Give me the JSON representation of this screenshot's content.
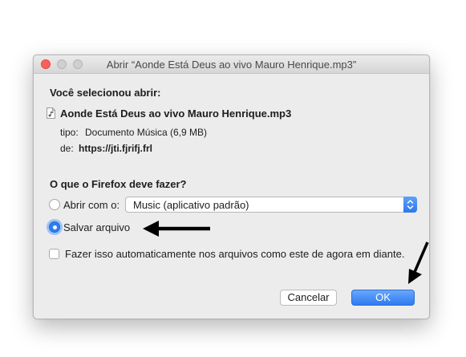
{
  "dialog": {
    "window_title": "Abrir “Aonde Está Deus ao vivo Mauro Henrique.mp3”",
    "heading": "Você selecionou abrir:",
    "file_name": "Aonde Está Deus ao vivo Mauro Henrique.mp3",
    "file_icon": "audio-file-icon",
    "type_label": "tipo:",
    "type_value": "Documento Música (6,9 MB)",
    "from_label": "de:",
    "from_value": "https://jti.fjrifj.frl",
    "question": "O que o Firefox deve fazer?",
    "open_with_label": "Abrir com o:",
    "open_with_selected": "Music (aplicativo padrão)",
    "save_label": "Salvar arquivo",
    "selected_option": "save",
    "auto_checkbox_label": "Fazer isso automaticamente nos arquivos como este de agora em diante.",
    "auto_checkbox_checked": false,
    "cancel_button": "Cancelar",
    "ok_button": "OK"
  },
  "annotations": {
    "arrow_color": "#000000",
    "arrows": [
      "pointer-to-save-option",
      "pointer-to-ok-button"
    ]
  },
  "colors": {
    "accent": "#2f7ef0",
    "dialog_bg": "#ececec",
    "close_button": "#fc605c"
  }
}
